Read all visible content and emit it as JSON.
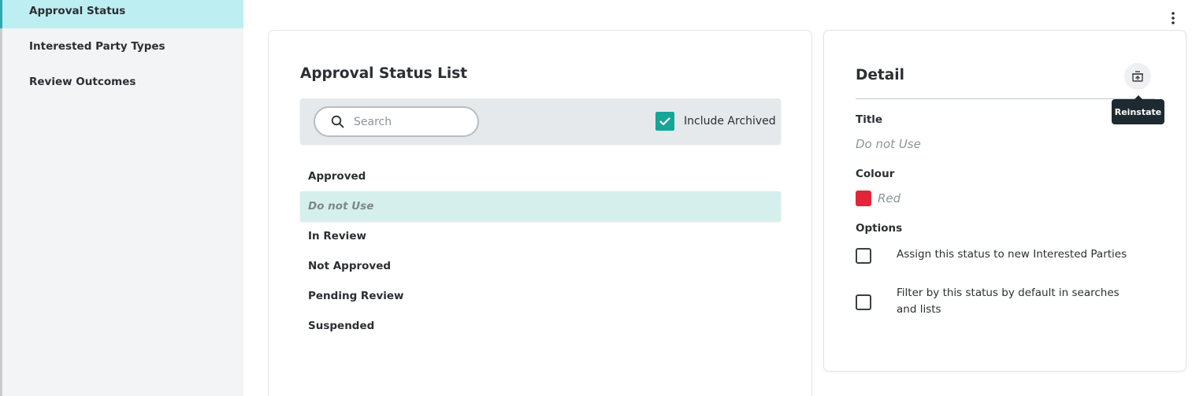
{
  "sidebar": {
    "items": [
      {
        "label": "Approval Status",
        "active": true
      },
      {
        "label": "Interested Party Types",
        "active": false
      },
      {
        "label": "Review Outcomes",
        "active": false
      }
    ]
  },
  "list": {
    "title": "Approval Status List",
    "search": {
      "placeholder": "Search",
      "value": ""
    },
    "include_archived": {
      "label": "Include Archived",
      "checked": true
    },
    "rows": [
      {
        "label": "Approved"
      },
      {
        "label": "Do not Use",
        "selected": true,
        "archived": true
      },
      {
        "label": "In Review"
      },
      {
        "label": "Not Approved"
      },
      {
        "label": "Pending Review"
      },
      {
        "label": "Suspended"
      }
    ]
  },
  "detail": {
    "title": "Detail",
    "reinstate_tooltip": "Reinstate",
    "title_label": "Title",
    "title_value": "Do not Use",
    "colour_label": "Colour",
    "colour_value": "Red",
    "colour_hex": "#e0263a",
    "options_label": "Options",
    "options": [
      {
        "label": "Assign this status to new Interested Parties",
        "checked": false
      },
      {
        "label": "Filter by this status by default in searches and lists",
        "checked": false
      }
    ]
  },
  "colors": {
    "accent": "#16a596",
    "sidebar_active": "#bdeff2",
    "selected_row": "#d5f0ec"
  },
  "icons": {
    "menu": "more-vertical-icon",
    "search": "search-icon",
    "check": "checkmark-icon",
    "reinstate": "reinstate-icon"
  }
}
